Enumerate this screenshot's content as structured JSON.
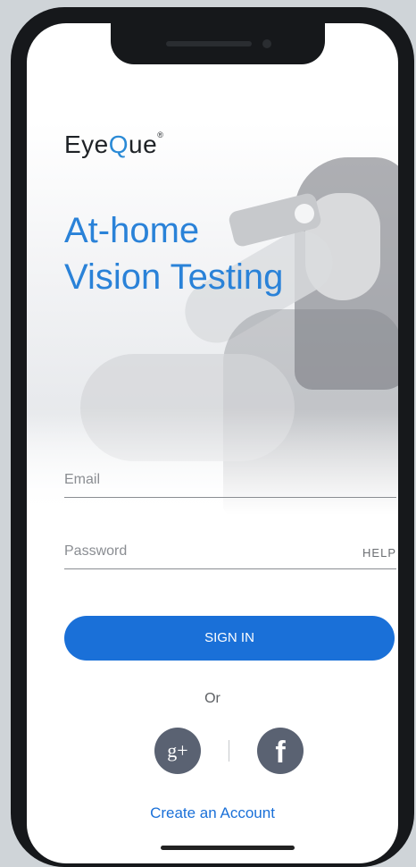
{
  "brand": {
    "name_prefix": "Eye",
    "name_q": "Q",
    "name_suffix": "ue",
    "registered": "®"
  },
  "hero": {
    "line1": "At-home",
    "line2": "Vision Testing"
  },
  "form": {
    "email_label": "Email",
    "password_label": "Password",
    "help_label": "HELP",
    "signin_label": "SIGN IN",
    "or_label": "Or"
  },
  "social": {
    "google_label": "g+",
    "facebook_label": "f"
  },
  "footer": {
    "create_account": "Create an Account"
  },
  "colors": {
    "accent": "#1a70d8",
    "headline": "#2a82d8",
    "social_bg": "#5a6272"
  },
  "icons": {
    "google": "google-plus-icon",
    "facebook": "facebook-icon"
  }
}
